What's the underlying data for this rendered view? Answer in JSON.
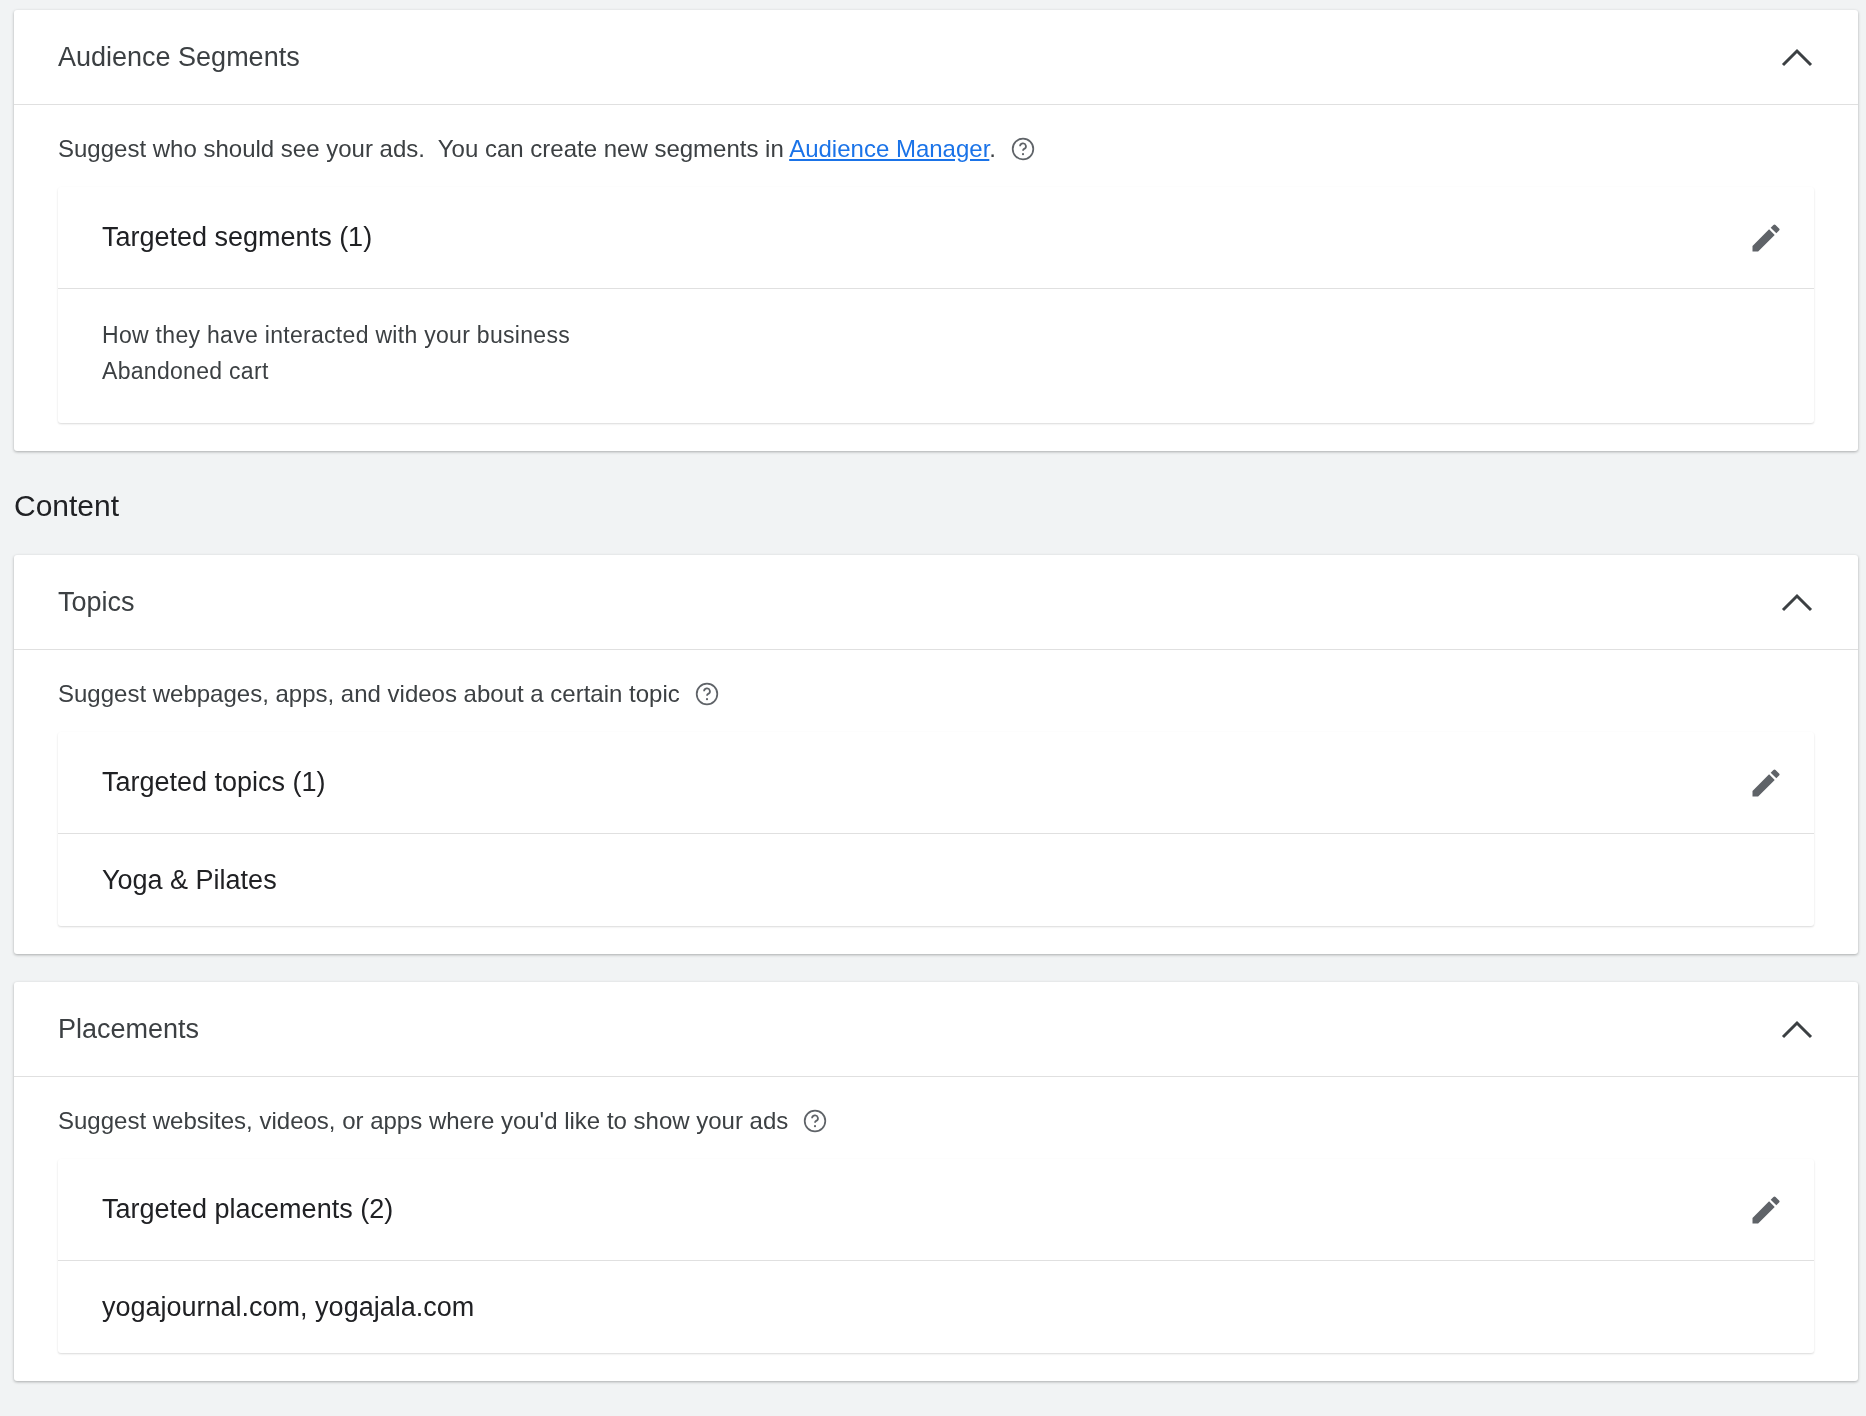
{
  "blocks": [
    {
      "kind": "card",
      "title": "Audience Segments",
      "expanded": true,
      "description": "Suggest who should see your ads.  You can create new segments in ",
      "link": "Audience Manager",
      "description_suffix": ".",
      "panel_heading": "Targeted segments (1)",
      "items": [
        {
          "kind": "detail",
          "text": "How they have interacted with your business"
        },
        {
          "kind": "detail",
          "text": "Abandoned cart"
        }
      ]
    },
    {
      "kind": "heading",
      "title": "Content"
    },
    {
      "kind": "card",
      "title": "Topics",
      "expanded": true,
      "description": "Suggest webpages, apps, and videos about a certain topic",
      "panel_heading": "Targeted topics (1)",
      "items": [
        {
          "kind": "value",
          "text": "Yoga & Pilates"
        }
      ]
    },
    {
      "kind": "card",
      "title": "Placements",
      "expanded": true,
      "description": "Suggest websites, videos, or apps where you'd like to show your ads",
      "panel_heading": "Targeted placements (2)",
      "items": [
        {
          "kind": "value",
          "text": "yogajournal.com, yogajala.com"
        }
      ]
    }
  ]
}
